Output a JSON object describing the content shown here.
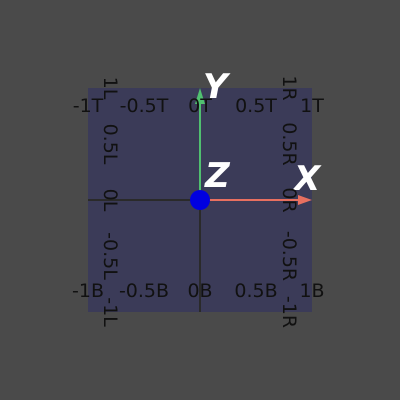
{
  "viewport": {
    "background": "#4a4a4a",
    "plane_color": "#3a3a5a",
    "grid_line_color": "#2a2a2a"
  },
  "axes": {
    "x": {
      "label": "X",
      "color": "#e87060"
    },
    "y": {
      "label": "Y",
      "color": "#50c070"
    },
    "z": {
      "label": "Z",
      "color": "#0000e0"
    }
  },
  "ticks": {
    "top": [
      "-1T",
      "-0.5T",
      "0T",
      "0.5T",
      "1T"
    ],
    "bottom": [
      "-1B",
      "-0.5B",
      "0B",
      "0.5B",
      "1B"
    ],
    "left": [
      "1L",
      "0.5L",
      "0L",
      "-0.5L",
      "-1L"
    ],
    "right": [
      "1R",
      "0.5R",
      "0R",
      "-0.5R",
      "-1R"
    ]
  }
}
